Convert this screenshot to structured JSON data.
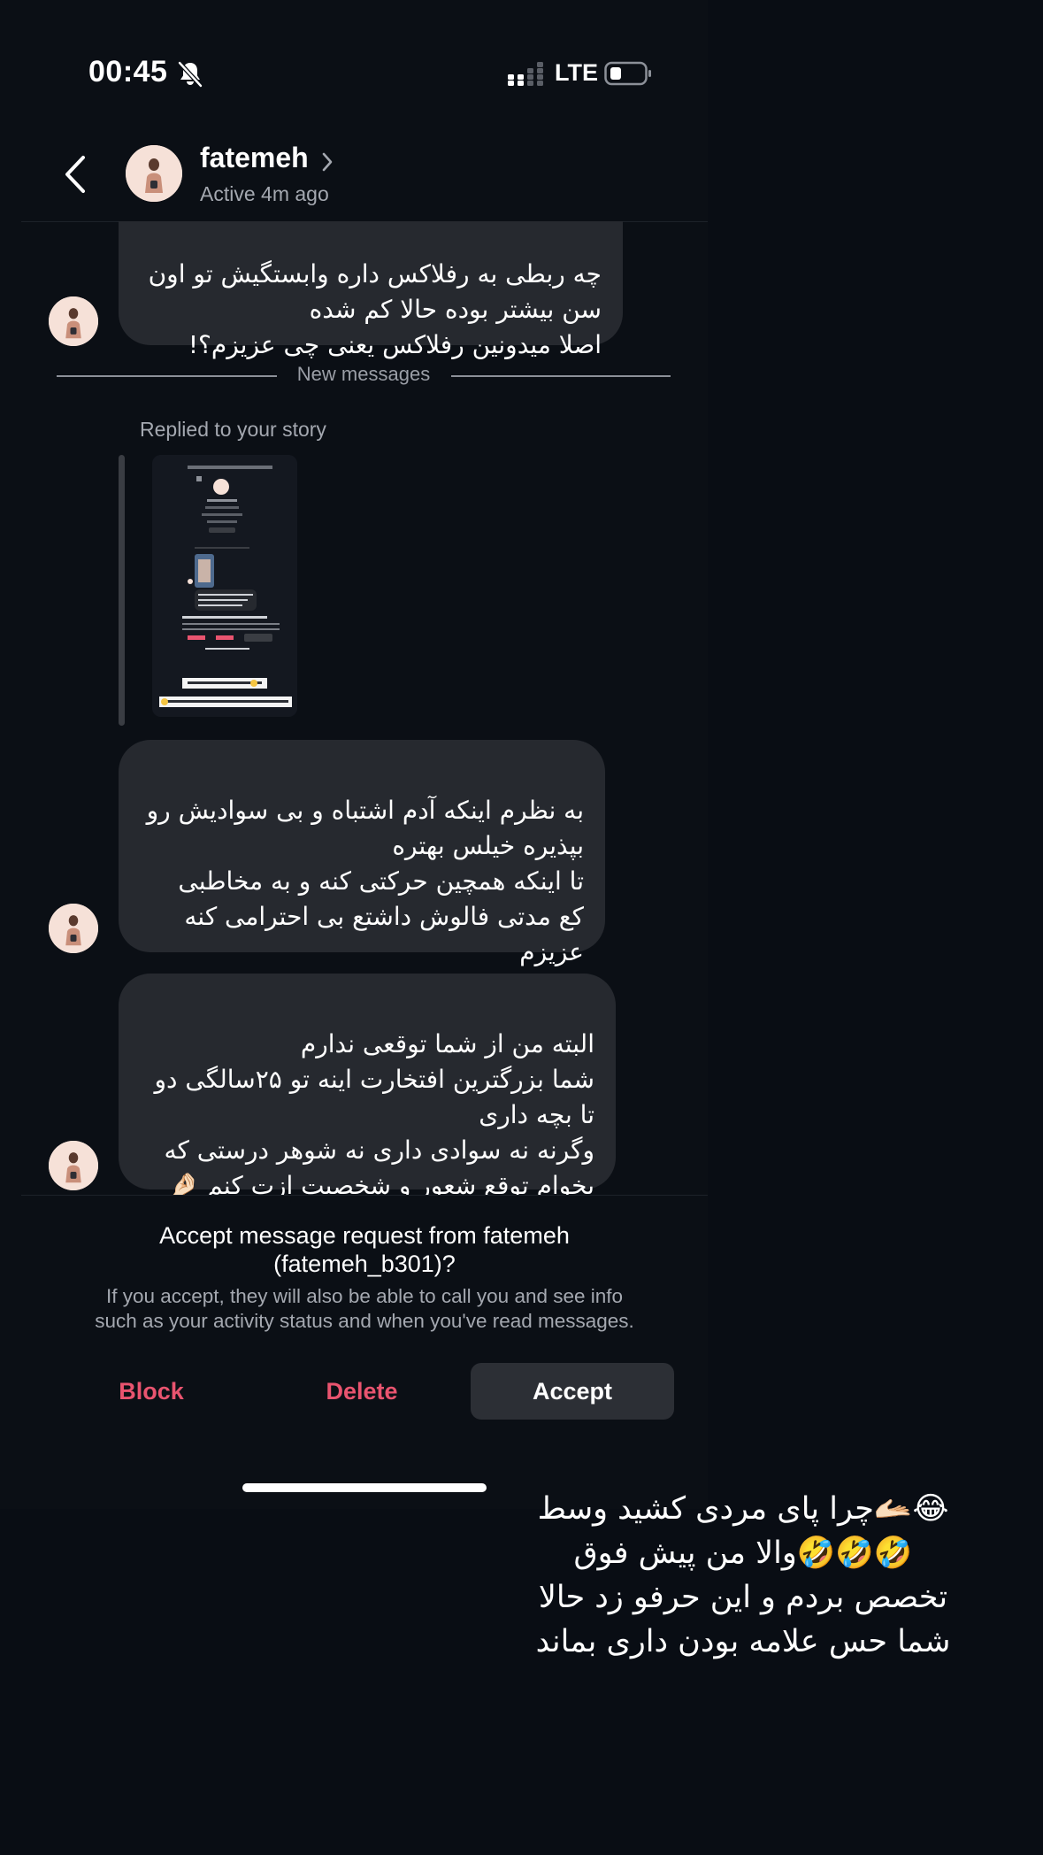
{
  "status_bar": {
    "time": "00:45",
    "network": "LTE"
  },
  "header": {
    "contact_name": "fatemeh",
    "active_status": "Active 4m ago"
  },
  "messages": [
    {
      "text": "چه ربطی به رفلاکس داره وابستگیش تو اون\nسن بیشتر بوده حالا کم شده\nاصلا میدونین رفلاکس یعنی چی عزیزم؟!"
    },
    {
      "text": "به نظرم اینکه آدم اشتباه و بی سوادیش رو\nبپذیره  خیلس بهتره\nتا اینکه همچین حرکتی کنه و به مخاطبی\nکع مدتی فالوش داشتع بی احترامی کنه\nعزیزم"
    },
    {
      "text": "البته من از شما توقعی ندارم\nشما بزرگترین افتخارت اینه تو ۲۵سالگی دو\nتا بچه داری\nوگرنه نه سوادی داری نه شوهر درستی که\nبخوام توقع شعور و شخصیت ازت کنم 🤌🏻"
    }
  ],
  "new_messages_label": "New messages",
  "story_reply": {
    "label": "Replied to your story"
  },
  "message_request": {
    "title_line1": "Accept message request from fatemeh",
    "title_line2": "(fatemeh_b301)?",
    "desc_line1": "If you accept, they will also be able to call you and see info",
    "desc_line2": "such as your activity status and when you've read messages.",
    "block_label": "Block",
    "delete_label": "Delete",
    "accept_label": "Accept"
  },
  "overlay_caption": "😂🫴🏻چرا پای مردی کشید وسط\n🤣🤣🤣والا من پیش فوق\nتخصص بردم و این حرفو زد حالا\nشما حس علامه بودن داری بماند",
  "colors": {
    "background": "#090d14",
    "bubble": "#26292f",
    "destructive": "#e9546f",
    "accept_button": "#2c2f35"
  }
}
